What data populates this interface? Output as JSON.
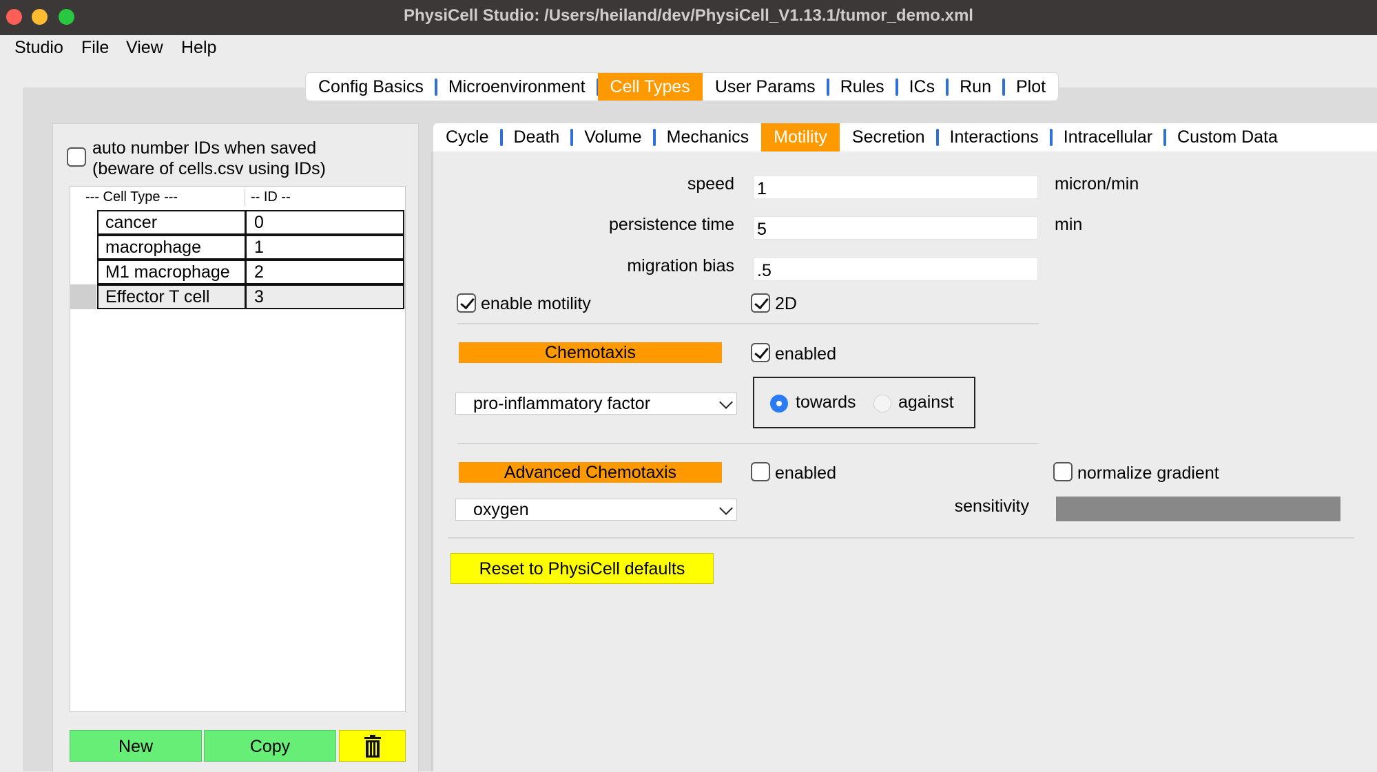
{
  "window": {
    "title": "PhysiCell Studio: /Users/heiland/dev/PhysiCell_V1.13.1/tumor_demo.xml",
    "traffic_lights": {
      "close": "#ff5f57",
      "minimize": "#febc2e",
      "zoom": "#28c840"
    }
  },
  "menu": [
    "Studio",
    "File",
    "View",
    "Help"
  ],
  "top_tabs": {
    "items": [
      "Config Basics",
      "Microenvironment",
      "Cell Types",
      "User Params",
      "Rules",
      "ICs",
      "Run",
      "Plot"
    ],
    "active": "Cell Types"
  },
  "left_panel": {
    "auto_number_checked": false,
    "auto_number_label_1": "auto number IDs when saved",
    "auto_number_label_2": "(beware of cells.csv using IDs)",
    "table": {
      "headers": [
        "---  Cell Type ---",
        "-- ID --"
      ],
      "rows": [
        {
          "name": "cancer",
          "id": "0"
        },
        {
          "name": "macrophage",
          "id": "1"
        },
        {
          "name": "M1 macrophage",
          "id": "2"
        },
        {
          "name": "Effector T cell",
          "id": "3"
        }
      ],
      "selected": "Effector T cell"
    },
    "buttons": {
      "new": "New",
      "copy": "Copy",
      "delete_icon": "trash-icon"
    }
  },
  "sub_tabs": {
    "items": [
      "Cycle",
      "Death",
      "Volume",
      "Mechanics",
      "Motility",
      "Secretion",
      "Interactions",
      "Intracellular",
      "Custom Data"
    ],
    "active": "Motility"
  },
  "motility": {
    "speed": {
      "label": "speed",
      "value": "1",
      "units": "micron/min"
    },
    "persistence_time": {
      "label": "persistence time",
      "value": "5",
      "units": "min"
    },
    "migration_bias": {
      "label": "migration bias",
      "value": ".5"
    },
    "enable_motility": {
      "label": "enable motility",
      "checked": true
    },
    "two_d": {
      "label": "2D",
      "checked": true
    },
    "chemotaxis": {
      "label": "Chemotaxis",
      "enabled_label": "enabled",
      "enabled": true,
      "substrate": "pro-inflammatory factor",
      "towards_label": "towards",
      "against_label": "against",
      "direction": "towards"
    },
    "advanced_chemotaxis": {
      "label": "Advanced Chemotaxis",
      "enabled_label": "enabled",
      "enabled": false,
      "normalize_label": "normalize gradient",
      "normalize": false,
      "substrate": "oxygen",
      "sensitivity_label": "sensitivity"
    },
    "reset_label": "Reset to PhysiCell defaults"
  },
  "colors": {
    "accent_orange": "#ff9900",
    "green_button": "#66ee77",
    "yellow_button": "#ffff00",
    "tab_separator": "#2f6fd6"
  }
}
